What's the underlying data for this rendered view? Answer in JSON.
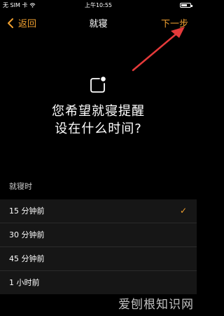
{
  "status_bar": {
    "carrier": "无 SIM 卡",
    "time": "上午10:55",
    "battery_level": 0.7
  },
  "nav": {
    "back_label": "返回",
    "title": "就寝",
    "next_label": "下一步"
  },
  "hero": {
    "title_line1": "您希望就寝提醒",
    "title_line2": "设在什么时间?"
  },
  "bedtime": {
    "header": "就寝时",
    "options": [
      {
        "label": "15 分钟前",
        "selected": true
      },
      {
        "label": "30 分钟前",
        "selected": false
      },
      {
        "label": "45 分钟前",
        "selected": false
      },
      {
        "label": "1 小时前",
        "selected": false
      }
    ]
  },
  "watermark": "爱刨根知识网",
  "colors": {
    "accent": "#f0a030",
    "annotation_arrow": "#e53a3a"
  }
}
